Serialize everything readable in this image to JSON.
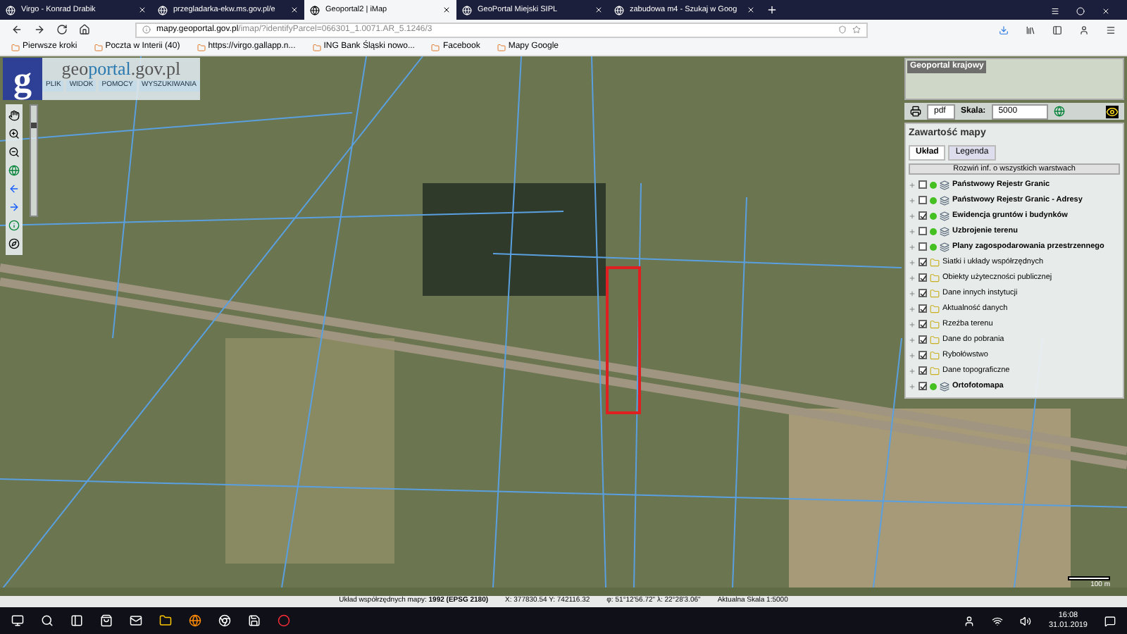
{
  "browser": {
    "tabs": [
      {
        "label": "Virgo - Konrad Drabik",
        "selected": false
      },
      {
        "label": "przegladarka-ekw.ms.gov.pl/e",
        "selected": false
      },
      {
        "label": "Geoportal2 | iMap",
        "selected": true
      },
      {
        "label": "GeoPortal Miejski SIPL",
        "selected": false
      },
      {
        "label": "zabudowa m4 - Szukaj w Goog",
        "selected": false
      }
    ],
    "address": {
      "domain": "mapy.geoportal.gov.pl",
      "path": "/imap/?identifyParcel=066301_1.0071.AR_5.1246/3"
    },
    "bookmarks": [
      "Pierwsze kroki",
      "Poczta w Interii (40)",
      "https://virgo.gallapp.n...",
      "ING Bank Śląski nowo...",
      "Facebook",
      "Mapy Google"
    ]
  },
  "header": {
    "logo_letter": "g",
    "site_a": "geo",
    "site_b": "portal",
    "site_c": ".gov.pl",
    "menu": [
      "PLIK",
      "WIDOK",
      "POMOCY",
      "WYSZUKIWANIA"
    ]
  },
  "overview": {
    "title": "Geoportal krajowy"
  },
  "toolbar": {
    "format": "pdf",
    "scale_label": "Skala:",
    "scale_value": "5000"
  },
  "panel": {
    "title": "Zawartość mapy",
    "tabs": [
      {
        "label": "Układ",
        "selected": true
      },
      {
        "label": "Legenda",
        "selected": false
      }
    ],
    "expand_button": "Rozwiń inf. o wszystkich warstwach",
    "layers": [
      {
        "name": "Państwowy Rejestr Granic",
        "kind": "group",
        "checked": false
      },
      {
        "name": "Państwowy Rejestr Granic - Adresy",
        "kind": "group",
        "checked": false
      },
      {
        "name": "Ewidencja gruntów i budynków",
        "kind": "group",
        "checked": true
      },
      {
        "name": "Uzbrojenie terenu",
        "kind": "group",
        "checked": false
      },
      {
        "name": "Plany zagospodarowania przestrzennego",
        "kind": "group",
        "checked": false
      },
      {
        "name": "Siatki i układy współrzędnych",
        "kind": "folder",
        "checked": true
      },
      {
        "name": "Obiekty użyteczności publicznej",
        "kind": "folder",
        "checked": true
      },
      {
        "name": "Dane innych instytucji",
        "kind": "folder",
        "checked": true
      },
      {
        "name": "Aktualność danych",
        "kind": "folder",
        "checked": true
      },
      {
        "name": "Rzeźba terenu",
        "kind": "folder",
        "checked": true
      },
      {
        "name": "Dane do pobrania",
        "kind": "folder",
        "checked": true
      },
      {
        "name": "Rybołówstwo",
        "kind": "folder",
        "checked": true
      },
      {
        "name": "Dane topograficzne",
        "kind": "folder",
        "checked": true
      },
      {
        "name": "Ortofotomapa",
        "kind": "group",
        "checked": true
      }
    ]
  },
  "zoom_slider": {
    "level": 0.85
  },
  "scale_bar": "100 m",
  "status_bar": {
    "crs_label": "Układ współrzędnych mapy:",
    "crs_value": "1992 (EPSG 2180)",
    "xy": "X: 377830.54 Y: 742116.32",
    "latlon": "φ: 51°12'56.72\" λ: 22°28'3.06\"",
    "scale": "Aktualna Skala 1:5000"
  },
  "taskbar": {
    "time": "16:08",
    "date": "31.01.2019"
  }
}
